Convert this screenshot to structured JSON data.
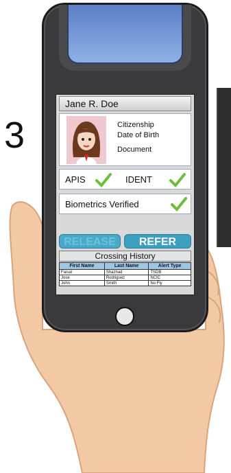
{
  "step": "3",
  "profile": {
    "name": "Jane R. Doe",
    "fields": [
      "Citizenship",
      "Date of Birth",
      "Document"
    ]
  },
  "checks": {
    "apis": "APIS",
    "ident": "IDENT",
    "biometrics": "Biometrics Verified"
  },
  "actions": {
    "release": "RELEASE",
    "refer": "REFER"
  },
  "history": {
    "title": "Crossing History",
    "columns": [
      "First Name",
      "Last Name",
      "Alert Type"
    ],
    "rows": [
      [
        "Faisal",
        "Shazhad",
        "TSDB"
      ],
      [
        "Jose",
        "Rodriguez",
        "NCIC"
      ],
      [
        "John",
        "Smith",
        "No Fly"
      ]
    ]
  },
  "colors": {
    "accent": "#3c9fc0",
    "check": "#6abf3a",
    "header": "#9fc6e0"
  }
}
